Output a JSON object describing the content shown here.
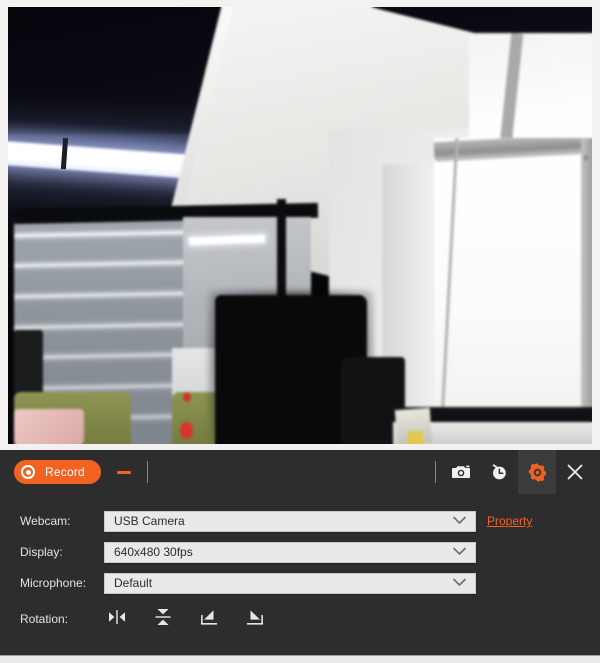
{
  "preview": {
    "name": "webcam-live-preview",
    "description": "Office interior: dark ceiling with fluorescent tube light, white soffit, window with potted plants on sill, glass partition with blinds, dark monitor silhouette"
  },
  "toolbar": {
    "record_label": "Record",
    "record_icon": "record-dot-icon",
    "minimize_icon": "minimize-icon",
    "snapshot_icon": "camera-icon",
    "timer_icon": "clock-icon",
    "settings_icon": "gear-icon",
    "close_icon": "close-icon",
    "accent_color": "#f26322",
    "background_color": "#2d2d2d",
    "active_tab_color": "#3b3b3b"
  },
  "settings": {
    "rows": [
      {
        "label": "Webcam:",
        "value": "USB Camera",
        "control": "dropdown"
      },
      {
        "label": "Display:",
        "value": "640x480 30fps",
        "control": "dropdown"
      },
      {
        "label": "Microphone:",
        "value": "Default",
        "control": "dropdown"
      },
      {
        "label": "Rotation:",
        "value": "",
        "control": "icon-buttons"
      }
    ],
    "property_link": "Property",
    "rotation_buttons": [
      {
        "name": "flip-horizontal-icon",
        "title": "Flip horizontal"
      },
      {
        "name": "flip-vertical-icon",
        "title": "Flip vertical"
      },
      {
        "name": "rotate-left-icon",
        "title": "Rotate left"
      },
      {
        "name": "rotate-right-icon",
        "title": "Rotate right"
      }
    ]
  }
}
